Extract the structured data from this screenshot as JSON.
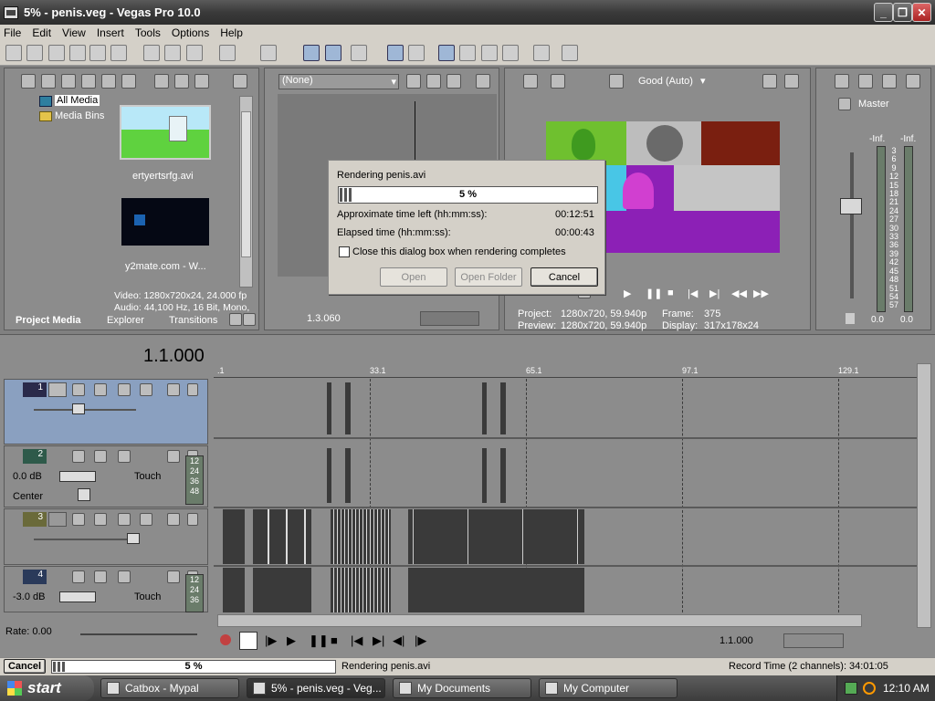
{
  "window": {
    "title": "5% - penis.veg - Vegas Pro 10.0"
  },
  "menu": [
    "File",
    "Edit",
    "View",
    "Insert",
    "Tools",
    "Options",
    "Help"
  ],
  "media": {
    "tree": [
      "All Media",
      "Media Bins"
    ],
    "items": [
      {
        "name": "ertyertsrfg.avi"
      },
      {
        "name": "y2mate.com - W..."
      }
    ],
    "info_video": "Video: 1280x720x24, 24.000 fp",
    "info_audio": "Audio: 44,100 Hz, 16 Bit, Mono,",
    "tabs": [
      "Project Media",
      "Explorer",
      "Transitions"
    ]
  },
  "trimmer": {
    "dropdown": "(None)",
    "timecode": "1.3.060"
  },
  "preview": {
    "quality": "Good (Auto)",
    "project_label": "Project:",
    "project_value": "1280x720, 59.940p",
    "preview_label": "Preview:",
    "preview_value": "1280x720, 59.940p",
    "frame_label": "Frame:",
    "frame_value": "375",
    "display_label": "Display:",
    "display_value": "317x178x24"
  },
  "master": {
    "title": "Master",
    "left_inf": "-Inf.",
    "right_inf": "-Inf.",
    "scale": [
      "3",
      "6",
      "9",
      "12",
      "15",
      "18",
      "21",
      "24",
      "27",
      "30",
      "33",
      "36",
      "39",
      "42",
      "45",
      "48",
      "51",
      "54",
      "57"
    ],
    "left_val": "0.0",
    "right_val": "0.0"
  },
  "dialog": {
    "title": "Rendering penis.avi",
    "progress_text": "5 %",
    "progress": 0.05,
    "time_left_label": "Approximate time left (hh:mm:ss):",
    "time_left_value": "00:12:51",
    "elapsed_label": "Elapsed time (hh:mm:ss):",
    "elapsed_value": "00:00:43",
    "checkbox_label": "Close this dialog box when rendering completes",
    "open": "Open",
    "open_folder": "Open Folder",
    "cancel": "Cancel"
  },
  "timeline": {
    "cursor_time": "1.1.000",
    "ruler": [
      ".1",
      "33.1",
      "65.1",
      "97.1",
      "129.1"
    ],
    "tracks": [
      {
        "num": "1",
        "type": "video"
      },
      {
        "num": "2",
        "type": "audio",
        "vol": "0.0 dB",
        "pan": "Center",
        "mode": "Touch",
        "meter": [
          "12",
          "24",
          "36",
          "48"
        ]
      },
      {
        "num": "3",
        "type": "video"
      },
      {
        "num": "4",
        "type": "audio",
        "vol": "-3.0 dB",
        "mode": "Touch",
        "meter": [
          "12",
          "24",
          "36"
        ]
      }
    ],
    "rate": "Rate: 0.00",
    "transport_time": "1.1.000"
  },
  "status": {
    "cancel": "Cancel",
    "progress_text": "5 %",
    "progress": 0.05,
    "message": "Rendering penis.avi",
    "record_time": "Record Time (2 channels): 34:01:05"
  },
  "taskbar": {
    "start": "start",
    "tasks": [
      "Catbox - Mypal",
      "5% - penis.veg - Veg...",
      "My Documents",
      "My Computer"
    ],
    "clock": "12:10 AM"
  }
}
